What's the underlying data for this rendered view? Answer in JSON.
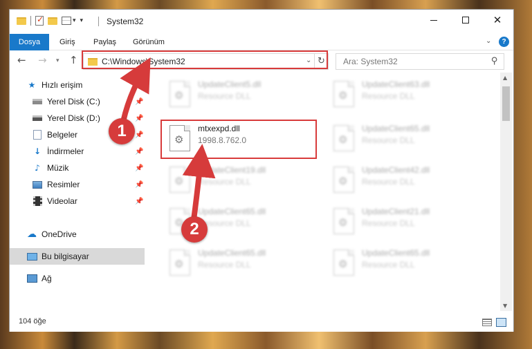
{
  "window": {
    "title": "System32",
    "controls": {
      "minimize": "minimize",
      "maximize": "maximize",
      "close": "✕"
    }
  },
  "ribbon": {
    "tabs": [
      "Dosya",
      "Giriş",
      "Paylaş",
      "Görünüm"
    ],
    "help": "?"
  },
  "nav": {
    "address": "C:\\Windows\\System32",
    "search_placeholder": "Ara: System32"
  },
  "sidebar": {
    "items": [
      {
        "label": "Hızlı erişim",
        "icon": "star-icon",
        "pinned": false
      },
      {
        "label": "Yerel Disk (C:)",
        "icon": "disk-icon",
        "pinned": true
      },
      {
        "label": "Yerel Disk (D:)",
        "icon": "disk-icon",
        "pinned": true
      },
      {
        "label": "Belgeler",
        "icon": "document-icon",
        "pinned": true
      },
      {
        "label": "İndirmeler",
        "icon": "download-icon",
        "pinned": true
      },
      {
        "label": "Müzik",
        "icon": "music-icon",
        "pinned": true
      },
      {
        "label": "Resimler",
        "icon": "pictures-icon",
        "pinned": true
      },
      {
        "label": "Videolar",
        "icon": "videos-icon",
        "pinned": true
      },
      {
        "label": "OneDrive",
        "icon": "cloud-icon",
        "pinned": false
      },
      {
        "label": "Bu bilgisayar",
        "icon": "computer-icon",
        "pinned": false,
        "selected": true
      },
      {
        "label": "Ağ",
        "icon": "network-icon",
        "pinned": false
      }
    ]
  },
  "files": [
    {
      "name": "UpdateClient5.dll",
      "desc": "Resource DLL",
      "blurred": true
    },
    {
      "name": "UpdateClient63.dll",
      "desc": "Resource DLL",
      "blurred": true
    },
    {
      "name": "mtxexpd.dll",
      "desc": "1998.8.762.0",
      "blurred": false
    },
    {
      "name": "UpdateClient65.dll",
      "desc": "Resource DLL",
      "blurred": true
    },
    {
      "name": "UpdateClient19.dll",
      "desc": "Resource DLL",
      "blurred": true
    },
    {
      "name": "UpdateClient42.dll",
      "desc": "Resource DLL",
      "blurred": true
    },
    {
      "name": "UpdateClient65.dll",
      "desc": "Resource DLL",
      "blurred": true
    },
    {
      "name": "UpdateClient21.dll",
      "desc": "Resource DLL",
      "blurred": true
    },
    {
      "name": "UpdateClient65.dll",
      "desc": "Resource DLL",
      "blurred": true
    },
    {
      "name": "UpdateClient65.dll",
      "desc": "Resource DLL",
      "blurred": true
    }
  ],
  "status": {
    "count": "104 öğe"
  },
  "annotations": {
    "step1": "1",
    "step2": "2",
    "highlight_color": "#d83a3a"
  },
  "colors": {
    "accent": "#1979ca",
    "badge": "#d63b3b"
  }
}
